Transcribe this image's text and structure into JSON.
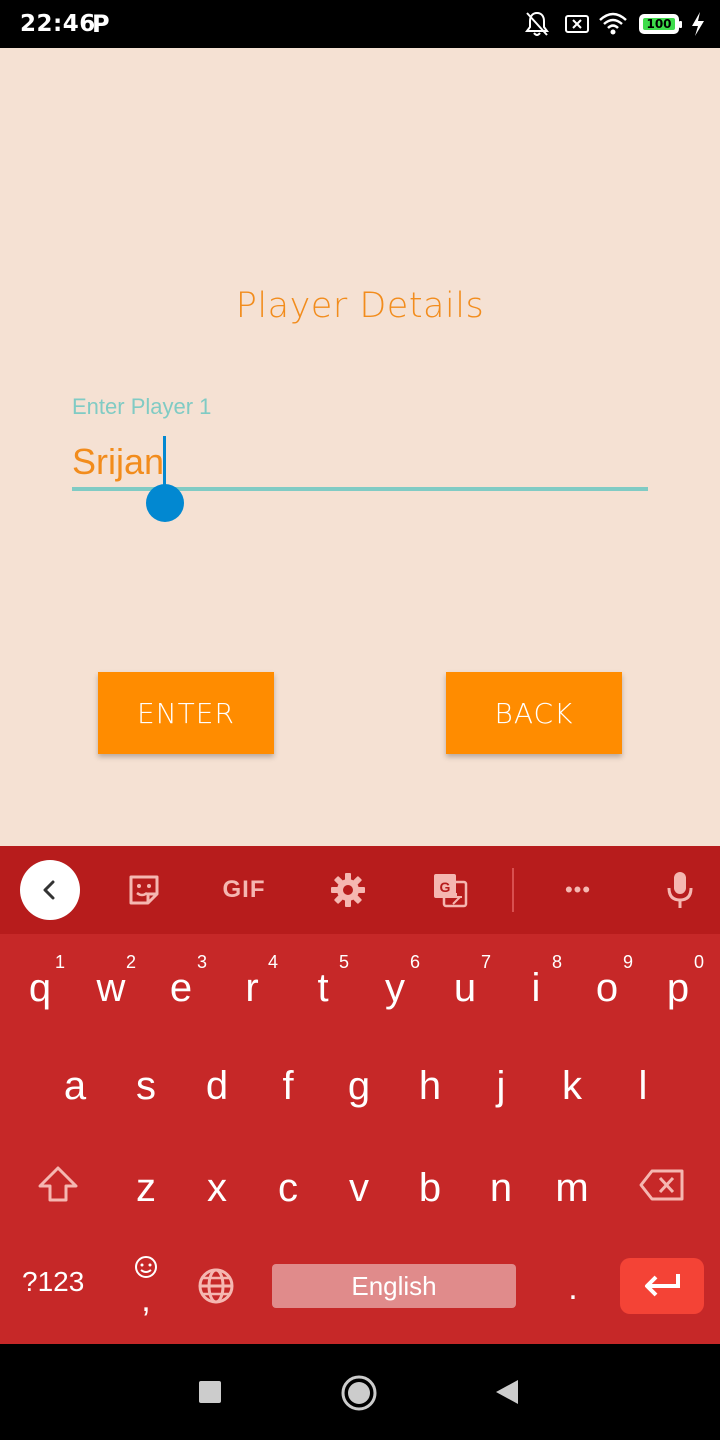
{
  "status_bar": {
    "time": "22:46",
    "p_icon": "P",
    "battery": "100"
  },
  "screen": {
    "title": "Player Details",
    "field_label": "Enter Player 1",
    "field_value": "Srijan",
    "enter_button": "ENTER",
    "back_button": "BACK"
  },
  "keyboard": {
    "toolbar": {
      "gif": "GIF",
      "more": "•••"
    },
    "row1": [
      {
        "key": "q",
        "hint": "1"
      },
      {
        "key": "w",
        "hint": "2"
      },
      {
        "key": "e",
        "hint": "3"
      },
      {
        "key": "r",
        "hint": "4"
      },
      {
        "key": "t",
        "hint": "5"
      },
      {
        "key": "y",
        "hint": "6"
      },
      {
        "key": "u",
        "hint": "7"
      },
      {
        "key": "i",
        "hint": "8"
      },
      {
        "key": "o",
        "hint": "9"
      },
      {
        "key": "p",
        "hint": "0"
      }
    ],
    "row2": [
      "a",
      "s",
      "d",
      "f",
      "g",
      "h",
      "j",
      "k",
      "l"
    ],
    "row3": [
      "z",
      "x",
      "c",
      "v",
      "b",
      "n",
      "m"
    ],
    "symbols": "?123",
    "comma": ",",
    "space": "English",
    "period": "."
  },
  "icons": {
    "status": [
      "notifications-off-icon",
      "sim-x-icon",
      "wifi-icon",
      "battery-icon",
      "charging-icon"
    ],
    "toolbar": [
      "back-arrow-icon",
      "sticker-icon",
      "gif-icon",
      "settings-icon",
      "translate-icon",
      "more-icon",
      "mic-icon"
    ],
    "nav": [
      "recents-icon",
      "home-icon",
      "back-icon"
    ]
  },
  "colors": {
    "background": "#F5E1D3",
    "accent_orange": "#FF8C00",
    "teal": "#80CBC4",
    "keyboard": "#C62828"
  }
}
